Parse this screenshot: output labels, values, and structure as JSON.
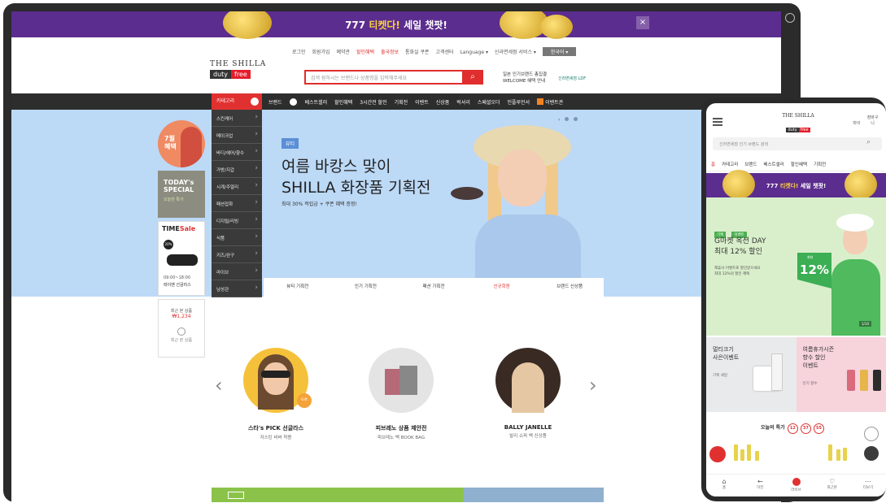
{
  "desktop": {
    "promo": {
      "prefix": "777 ",
      "highlight": "티켓다!",
      "suffix": " 세일 챗팟!",
      "close": "×"
    },
    "util_links": [
      "로그인",
      "회원가입",
      "예약관",
      "할인혜택",
      "출국정보",
      "통화실 쿠폰",
      "고객센터",
      "Language ▾",
      "신라면세점 서비스 ▾"
    ],
    "lang_button": "한국어 ▾",
    "logo": {
      "line1": "THE SHILLA",
      "word_a": "duty",
      "word_b": "free"
    },
    "search": {
      "placeholder": "검색 원하시는 브랜드나 상품명을 입력해주세요",
      "button": "⌕"
    },
    "header_ad": {
      "line1": "일본 인기브랜드 총집결",
      "line2": "WELCOME 혜택 안내"
    },
    "header_ad2": "신라면세점 LDF",
    "gnb": {
      "all_category": "카테고리",
      "brand": "브랜드",
      "items": [
        "베스트셀러",
        "할인혜택",
        "3시간전 할인",
        "기획전",
        "이벤트",
        "신상품",
        "럭셔리",
        "스페셜오더",
        "인플루언서"
      ],
      "last": "이벤트관"
    },
    "category_menu": [
      "스킨케어",
      "메이크업",
      "바디/헤어/향수",
      "가방/지갑",
      "시계/주얼리",
      "패션잡화",
      "디지털/리빙",
      "식품",
      "키즈/완구",
      "라이브",
      "남성관"
    ],
    "hero": {
      "tag": "뷰티",
      "title_line1": "여름 바캉스 맞이",
      "title_line2": "SHILLA 화장품 기획전",
      "subtitle": "최대 30% 적립금 + 쿠폰 혜택 증정!",
      "tabs": [
        "뷰티 기획전",
        "인기 기획전",
        "패션 기획전",
        "신규회원",
        "브랜드 신상품"
      ]
    },
    "side": {
      "circle_text_1": "7월",
      "circle_text_2": "혜택",
      "today_1": "TODAY's",
      "today_2": "SPECIAL",
      "today_sub": "오늘만 특가",
      "timesale_a": "TIME",
      "timesale_b": "Sale",
      "timesale_badge": "20%",
      "timesale_time": "09:00~18:00",
      "timesale_brand": "레이밴 선글라스",
      "recent_label": "최근 본 상품",
      "recent_value": "₩1,234",
      "recent_more": "최근 본 상품"
    },
    "products": [
      {
        "title": "스타's PICK 선글라스",
        "subtitle": "저스틴 비버 착용",
        "badge": "Gift"
      },
      {
        "title": "피브레노 상품 제안전",
        "subtitle": "피브레노 백 BOOK BAG",
        "badge": ""
      },
      {
        "title": "BALLY JANELLE",
        "subtitle": "발리 쇼퍼 백 신상품",
        "badge": ""
      }
    ]
  },
  "mobile": {
    "logo": {
      "line1": "THE SHILLA",
      "word_a": "duty",
      "word_b": "free"
    },
    "icons": [
      "마이",
      "장바구니"
    ],
    "search_placeholder": "신라면세점 인기 브랜드 검색",
    "tabs": [
      "홈",
      "카테고리",
      "브랜드",
      "베스트셀러",
      "할인혜택",
      "기획전"
    ],
    "promo": {
      "prefix": "777 ",
      "highlight": "티켓다!",
      "suffix": " 세일 챗팟!"
    },
    "hero": {
      "tags": [
        "기획",
        "이벤트"
      ],
      "title_1": "G마켓 옥션 DAY",
      "title_2": "최대 12% 할인",
      "sub_1": "제휴사 이벤트로 할인받으세요",
      "sub_2": "최대 12%의 할인 혜택",
      "discount": "12",
      "discount_label": "최대",
      "page": "1/10"
    },
    "cards": [
      {
        "title_1": "멀티크기",
        "title_2": "사은이벤트",
        "sub": "기획 세일"
      },
      {
        "title_1": "여름휴가시즌",
        "title_2": "향수 할인",
        "title_3": "이벤트",
        "sub": "인기 향수"
      }
    ],
    "today": {
      "label": "오늘의 특가",
      "hh": "12",
      "mm": "37",
      "ss": "55"
    },
    "bottom": [
      {
        "icon": "⌂",
        "label": "홈"
      },
      {
        "icon": "←",
        "label": "이전"
      },
      {
        "icon": "",
        "label": "라이브"
      },
      {
        "icon": "♡",
        "label": "최근본"
      },
      {
        "icon": "⋯",
        "label": "더보기"
      }
    ]
  }
}
